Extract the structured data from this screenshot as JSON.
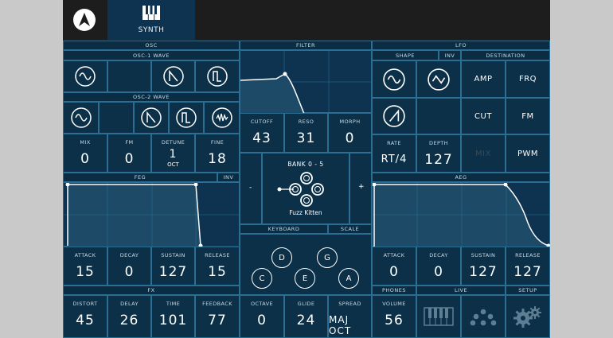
{
  "topbar": {
    "synth_tab": "SYNTH"
  },
  "osc": {
    "header": "OSC",
    "osc1_header": "OSC-1 WAVE",
    "osc2_header": "OSC-2 WAVE",
    "knobs": [
      {
        "label": "MIX",
        "value": "0"
      },
      {
        "label": "FM",
        "value": "0"
      },
      {
        "label": "DETUNE",
        "value": "1",
        "sub": "OCT"
      },
      {
        "label": "FINE",
        "value": "18"
      }
    ]
  },
  "filter": {
    "header": "FILTER",
    "knobs": [
      {
        "label": "CUTOFF",
        "value": "43"
      },
      {
        "label": "RESO",
        "value": "31"
      },
      {
        "label": "MORPH",
        "value": "0"
      }
    ]
  },
  "lfo": {
    "header": "LFO",
    "shape_header": "SHAPE",
    "inv": "INV",
    "destination_header": "DESTINATION",
    "destinations": [
      "AMP",
      "FRQ",
      "CUT",
      "FM",
      "MIX",
      "PWM"
    ],
    "knobs": [
      {
        "label": "RATE",
        "value": "RT/4"
      },
      {
        "label": "DEPTH",
        "value": "127"
      }
    ]
  },
  "feg": {
    "header": "FEG",
    "inv": "INV",
    "knobs": [
      {
        "label": "ATTACK",
        "value": "15"
      },
      {
        "label": "DECAY",
        "value": "0"
      },
      {
        "label": "SUSTAIN",
        "value": "127"
      },
      {
        "label": "RELEASE",
        "value": "15"
      }
    ]
  },
  "aeg": {
    "header": "AEG",
    "knobs": [
      {
        "label": "ATTACK",
        "value": "0"
      },
      {
        "label": "DECAY",
        "value": "0"
      },
      {
        "label": "SUSTAIN",
        "value": "127"
      },
      {
        "label": "RELEASE",
        "value": "127"
      }
    ]
  },
  "bank": {
    "title": "BANK 0 - 5",
    "preset": "Fuzz Kitten",
    "minus": "-",
    "plus": "+"
  },
  "keyboard": {
    "header": "KEYBOARD",
    "scale": "SCALE",
    "notes": [
      "D",
      "G",
      "C",
      "E",
      "A"
    ]
  },
  "fx": {
    "header": "FX",
    "knobs": [
      {
        "label": "DISTORT",
        "value": "45"
      },
      {
        "label": "DELAY",
        "value": "26"
      },
      {
        "label": "TIME",
        "value": "101"
      },
      {
        "label": "FEEDBACK",
        "value": "77"
      }
    ]
  },
  "play": {
    "knobs": [
      {
        "label": "OCTAVE",
        "value": "0"
      },
      {
        "label": "GLIDE",
        "value": "24"
      },
      {
        "label": "SPREAD",
        "value": "MAJ OCT"
      }
    ]
  },
  "phones": {
    "header": "PHONES",
    "label": "VOLUME",
    "value": "56"
  },
  "live": {
    "header": "LIVE"
  },
  "setup": {
    "header": "SETUP"
  },
  "colors": {
    "bg": "#0a2a3e",
    "border": "#2a6f93",
    "selected": "#ffffff",
    "topbar": "#1d1d1d"
  }
}
